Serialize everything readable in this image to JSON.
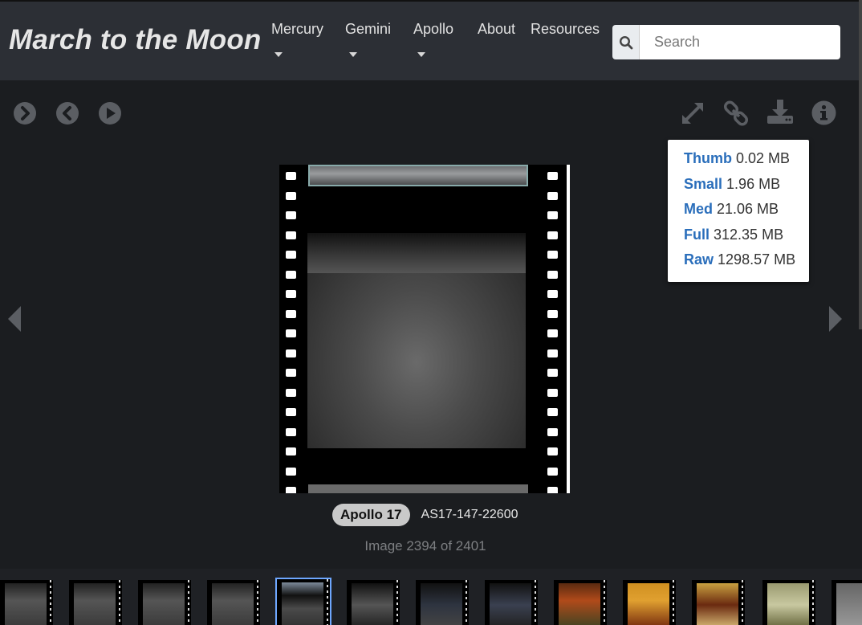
{
  "brand": "March to the Moon",
  "nav": {
    "mercury": "Mercury",
    "gemini": "Gemini",
    "apollo": "Apollo",
    "about": "About",
    "resources": "Resources"
  },
  "search": {
    "placeholder": "Search"
  },
  "download_menu": [
    {
      "label": "Thumb",
      "size": "0.02 MB"
    },
    {
      "label": "Small",
      "size": "1.96 MB"
    },
    {
      "label": "Med",
      "size": "21.06 MB"
    },
    {
      "label": "Full",
      "size": "312.35 MB"
    },
    {
      "label": "Raw",
      "size": "1298.57 MB"
    }
  ],
  "image": {
    "mission": "Apollo 17",
    "id": "AS17-147-22600",
    "counter": "Image 2394 of 2401"
  },
  "colors": {
    "link": "#2a6ebb",
    "navbar": "#2c2f35",
    "background": "#1b1d20",
    "active_thumb": "#6ea7ff"
  },
  "thumbnails_active_index": 4
}
